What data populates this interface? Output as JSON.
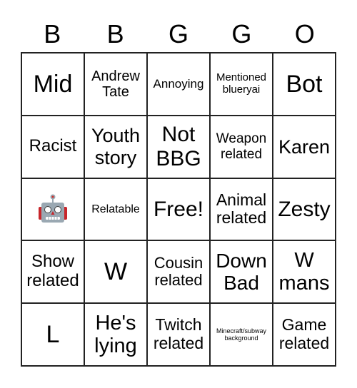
{
  "header": [
    "B",
    "B",
    "G",
    "G",
    "O"
  ],
  "cells": [
    "Mid",
    "Andrew Tate",
    "Annoying",
    "Mentioned blueryai",
    "Bot",
    "Racist",
    "Youth story",
    "Not BBG",
    "Weapon related",
    "Karen",
    "",
    "Relatable",
    "Free!",
    "Animal related",
    "Zesty",
    "Show related",
    "W",
    "Cousin related",
    "Down Bad",
    "W mans",
    "L",
    "He's lying",
    "Twitch related",
    "Minecraft/subway background",
    "Game related"
  ],
  "robot_cell_icon": "robot-icon"
}
